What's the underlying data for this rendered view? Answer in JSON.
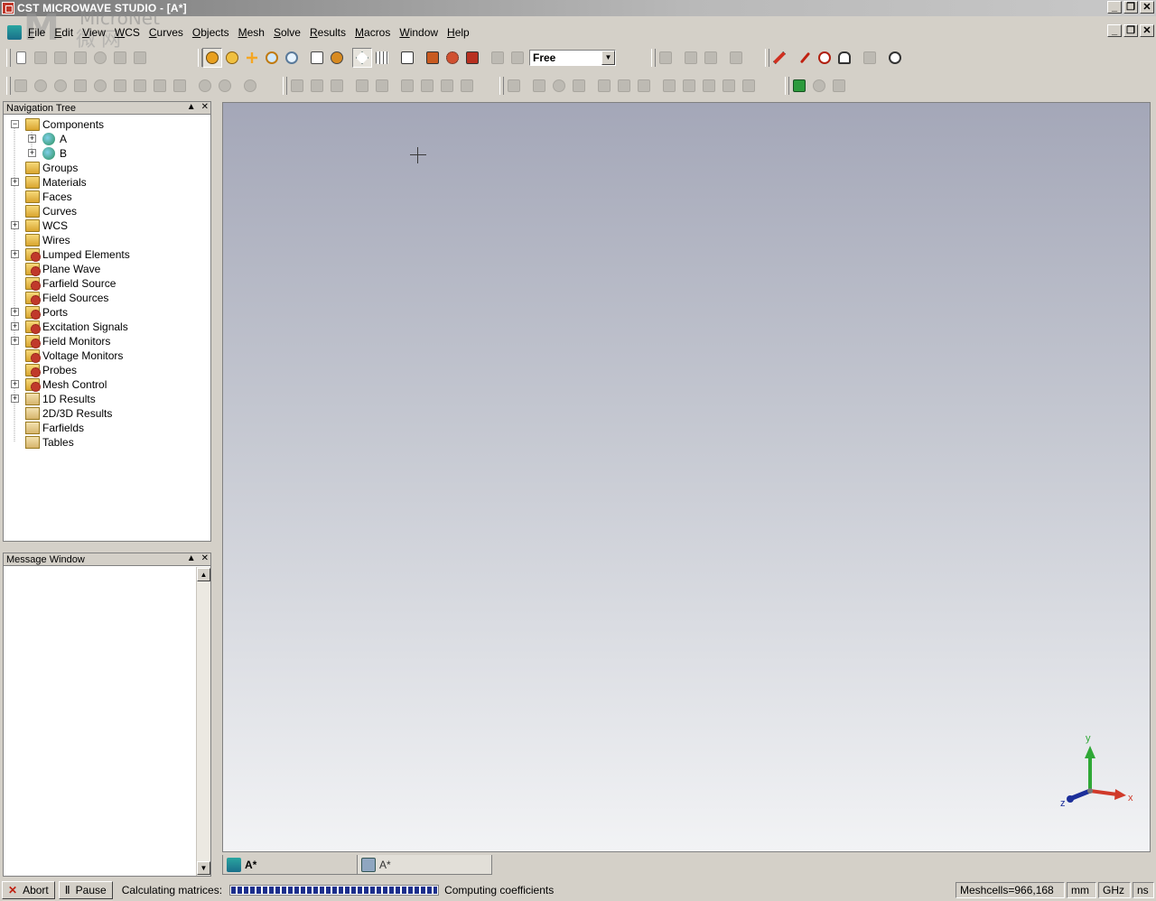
{
  "window": {
    "title": "CST MICROWAVE STUDIO - [A*]",
    "buttons": [
      "_",
      "❐",
      "✕"
    ]
  },
  "watermark": {
    "text": "MicroNet",
    "cn": "微网"
  },
  "menu": {
    "items": [
      {
        "label": "File",
        "u": "F",
        "rest": "ile"
      },
      {
        "label": "Edit",
        "u": "E",
        "rest": "dit"
      },
      {
        "label": "View",
        "u": "V",
        "rest": "iew"
      },
      {
        "label": "WCS",
        "u": "W",
        "rest": "CS"
      },
      {
        "label": "Curves",
        "u": "C",
        "rest": "urves"
      },
      {
        "label": "Objects",
        "u": "O",
        "rest": "bjects"
      },
      {
        "label": "Mesh",
        "u": "M",
        "rest": "esh"
      },
      {
        "label": "Solve",
        "u": "S",
        "rest": "olve"
      },
      {
        "label": "Results",
        "u": "R",
        "rest": "esults"
      },
      {
        "label": "Macros",
        "u": "M",
        "rest": "acros"
      },
      {
        "label": "Window",
        "u": "W",
        "rest": "indow"
      },
      {
        "label": "Help",
        "u": "H",
        "rest": "elp"
      }
    ]
  },
  "toolbar": {
    "view_mode": "Free",
    "view_mode_arrow": "▼"
  },
  "nav_tree": {
    "title": "Navigation Tree",
    "pin": "▲",
    "close": "✕",
    "items": [
      {
        "label": "Components",
        "level": 0,
        "expander": "−",
        "icon": "folder-icon"
      },
      {
        "label": "A",
        "level": 1,
        "expander": "+",
        "icon": "component-icon"
      },
      {
        "label": "B",
        "level": 1,
        "expander": "+",
        "icon": "component-icon"
      },
      {
        "label": "Groups",
        "level": 0,
        "expander": "",
        "icon": "folder-icon"
      },
      {
        "label": "Materials",
        "level": 0,
        "expander": "+",
        "icon": "folder-icon"
      },
      {
        "label": "Faces",
        "level": 0,
        "expander": "",
        "icon": "folder-icon"
      },
      {
        "label": "Curves",
        "level": 0,
        "expander": "",
        "icon": "folder-icon"
      },
      {
        "label": "WCS",
        "level": 0,
        "expander": "+",
        "icon": "folder-icon"
      },
      {
        "label": "Wires",
        "level": 0,
        "expander": "",
        "icon": "folder-icon"
      },
      {
        "label": "Lumped Elements",
        "level": 0,
        "expander": "+",
        "icon": "folder-gear-icon"
      },
      {
        "label": "Plane Wave",
        "level": 0,
        "expander": "",
        "icon": "folder-gear-icon"
      },
      {
        "label": "Farfield Source",
        "level": 0,
        "expander": "",
        "icon": "folder-gear-icon"
      },
      {
        "label": "Field Sources",
        "level": 0,
        "expander": "",
        "icon": "folder-gear-icon"
      },
      {
        "label": "Ports",
        "level": 0,
        "expander": "+",
        "icon": "folder-gear-icon"
      },
      {
        "label": "Excitation Signals",
        "level": 0,
        "expander": "+",
        "icon": "folder-gear-icon"
      },
      {
        "label": "Field Monitors",
        "level": 0,
        "expander": "+",
        "icon": "folder-gear-icon"
      },
      {
        "label": "Voltage Monitors",
        "level": 0,
        "expander": "",
        "icon": "folder-gear-icon"
      },
      {
        "label": "Probes",
        "level": 0,
        "expander": "",
        "icon": "folder-gear-icon"
      },
      {
        "label": "Mesh Control",
        "level": 0,
        "expander": "+",
        "icon": "folder-gear-icon"
      },
      {
        "label": "1D Results",
        "level": 0,
        "expander": "+",
        "icon": "results-folder-icon"
      },
      {
        "label": "2D/3D Results",
        "level": 0,
        "expander": "",
        "icon": "results-folder-icon"
      },
      {
        "label": "Farfields",
        "level": 0,
        "expander": "",
        "icon": "results-folder-icon"
      },
      {
        "label": "Tables",
        "level": 0,
        "expander": "",
        "icon": "results-folder-icon"
      }
    ]
  },
  "message_window": {
    "title": "Message Window",
    "pin": "▲",
    "close": "✕",
    "scroll_up": "▲",
    "scroll_down": "▼"
  },
  "viewport": {
    "axes": {
      "y": "y",
      "x": "x",
      "z": "z"
    }
  },
  "doc_tabs": [
    {
      "label": "A*",
      "active": true
    },
    {
      "label": "A*",
      "active": false
    }
  ],
  "statusbar": {
    "abort_label": "Abort",
    "abort_glyph": "✕",
    "pause_label": "Pause",
    "pause_glyph": "Ⅱ",
    "calc_label": "Calculating matrices:",
    "progress": 1.0,
    "status_text": "Computing coefficients",
    "meshcells": "Meshcells=966,168",
    "unit_length": "mm",
    "unit_freq": "GHz",
    "unit_time": "ns"
  }
}
